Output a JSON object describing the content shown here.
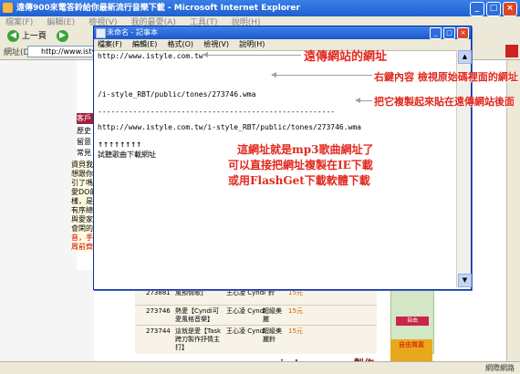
{
  "browser": {
    "title": "遠傳900來電答鈴給你最新流行音樂下載 - Microsoft Internet Explorer",
    "menu": [
      "檔案(F)",
      "編輯(E)",
      "檢視(V)",
      "我的最愛(A)",
      "工具(T)",
      "說明(H)"
    ],
    "back_label": "上一頁",
    "address_label": "網址(D)",
    "address_value": "http://www.istyle.com",
    "status_left": "",
    "status_right": "網際網路"
  },
  "page_behind": {
    "nav_items": [
      "",
      "",
      "",
      "",
      "",
      "系統",
      "歷史",
      "留意",
      "常見"
    ],
    "customer_label": "客戶",
    "blurb_lines": [
      "資貝我",
      "想跟你",
      "引了嗎",
      "愛DO的",
      "樣，是",
      "有序總",
      "與愛家",
      "會閑的",
      "音，手",
      "周前齊"
    ],
    "rows": [
      {
        "id": "273881",
        "title": "風預情歌]",
        "artist": "王心凌 Cyndi",
        "note": "鈴",
        "price": "15元"
      },
      {
        "id": "273746",
        "title": "熱愛【Cyndi可愛風格音樂】",
        "artist": "王心凌 Cyndi",
        "note": "超級美麗",
        "price": "15元"
      },
      {
        "id": "273744",
        "title": "這就是愛【Task跨刀製作抒情主打】",
        "artist": "王心凌 Cyndi",
        "note": "超級美麗鈴",
        "price": "15元"
      }
    ],
    "ad_badge": "自由",
    "ad_bottom": "自由賞嘉",
    "watermark": "vipdoraemons製作"
  },
  "notepad": {
    "title": "未命名 - 記事本",
    "menu": [
      "檔案(F)",
      "編輯(E)",
      "格式(O)",
      "檢視(V)",
      "說明(H)"
    ],
    "lines": [
      "http://www.istyle.com.tw",
      "/i-style_RBT/public/tones/273746.wma",
      "------------------------------------------------------",
      "http://www.istyle.com.tw/i-style_RBT/public/tones/273746.wma",
      "↑↑↑↑↑↑↑↑",
      "試聽歌曲下載網址"
    ]
  },
  "annotations": {
    "site_url": "遠傳網站的網址",
    "view_source": "右鍵內容 檢視原始碼裡面的網址",
    "copy_paste": "把它複製起來貼在遠傳網站後面",
    "mp3_1": "這網址就是mp3歌曲網址了",
    "mp3_2": "可以直接把網址複製在IE下載",
    "mp3_3": "或用FlashGet下載軟體下載"
  }
}
